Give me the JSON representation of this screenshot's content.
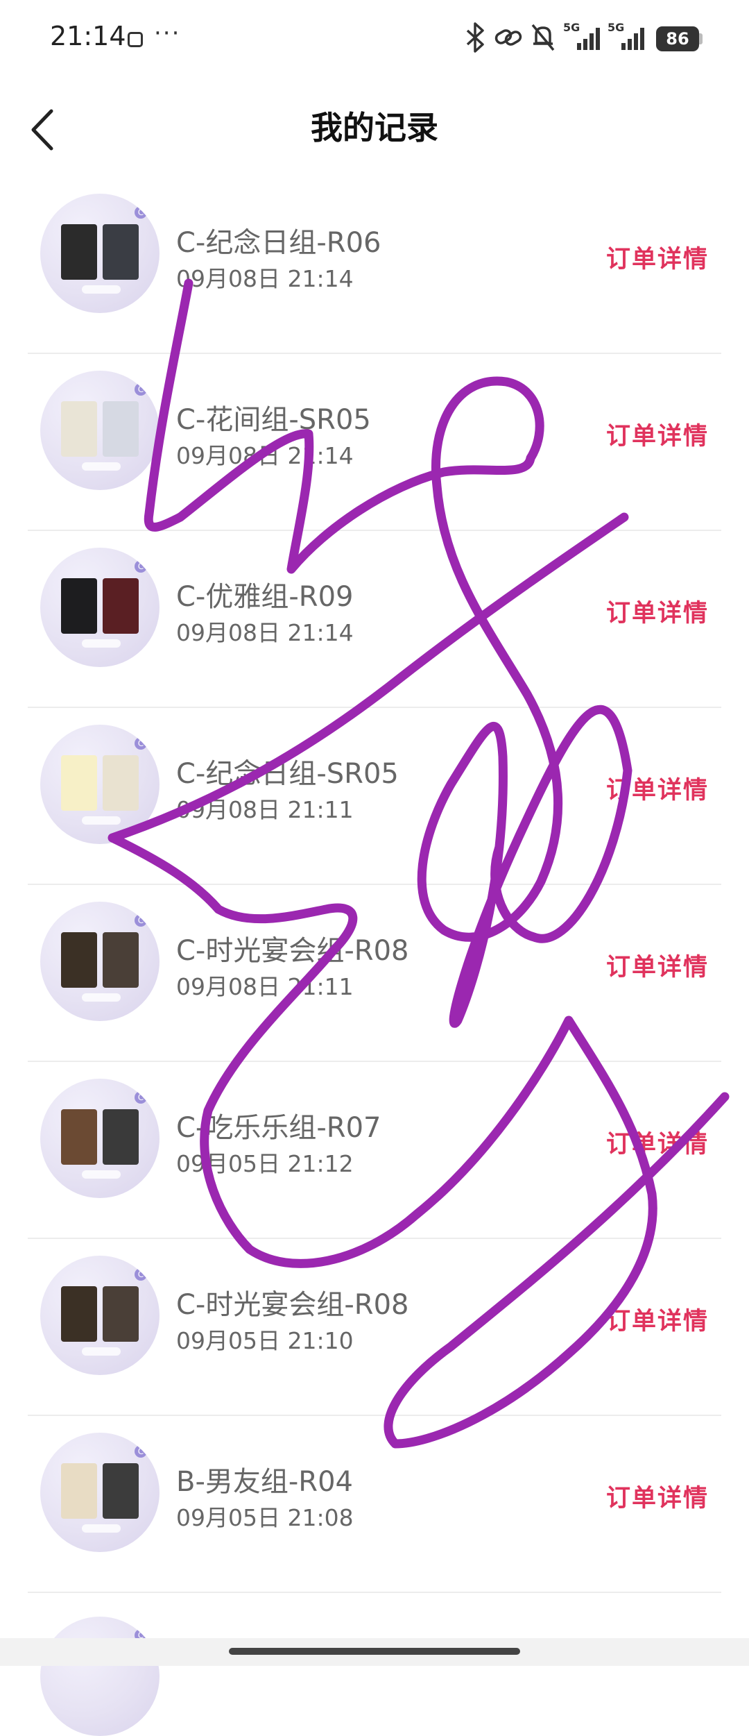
{
  "status_bar": {
    "time": "21:14",
    "more": "···",
    "network_1": "5G",
    "network_2": "5G",
    "battery": "86"
  },
  "header": {
    "title": "我的记录"
  },
  "records": [
    {
      "name": "C-纪念日组-R06",
      "date": "09月08日 21:14",
      "detail_label": "订单详情",
      "card_colors": [
        "#2b2b2b",
        "#3a3d44"
      ]
    },
    {
      "name": "C-花间组-SR05",
      "date": "09月08日 21:14",
      "detail_label": "订单详情",
      "card_colors": [
        "#e9e4d6",
        "#d6d9e3"
      ]
    },
    {
      "name": "C-优雅组-R09",
      "date": "09月08日 21:14",
      "detail_label": "订单详情",
      "card_colors": [
        "#1d1d1f",
        "#5a1f23"
      ]
    },
    {
      "name": "C-纪念日组-SR05",
      "date": "09月08日 21:11",
      "detail_label": "订单详情",
      "card_colors": [
        "#f7f0c7",
        "#e9e2d0"
      ]
    },
    {
      "name": "C-时光宴会组-R08",
      "date": "09月08日 21:11",
      "detail_label": "订单详情",
      "card_colors": [
        "#3b3025",
        "#4a3f37"
      ]
    },
    {
      "name": "C-吃乐乐组-R07",
      "date": "09月05日 21:12",
      "detail_label": "订单详情",
      "card_colors": [
        "#6b4a33",
        "#3a3a3a"
      ]
    },
    {
      "name": "C-时光宴会组-R08",
      "date": "09月05日 21:10",
      "detail_label": "订单详情",
      "card_colors": [
        "#3b3025",
        "#4a3f37"
      ]
    },
    {
      "name": "B-男友组-R04",
      "date": "09月05日 21:08",
      "detail_label": "订单详情",
      "card_colors": [
        "#e8dcc4",
        "#3c3c3c"
      ]
    }
  ],
  "colors": {
    "accent": "#e0335d",
    "scribble": "#9b27b0"
  }
}
